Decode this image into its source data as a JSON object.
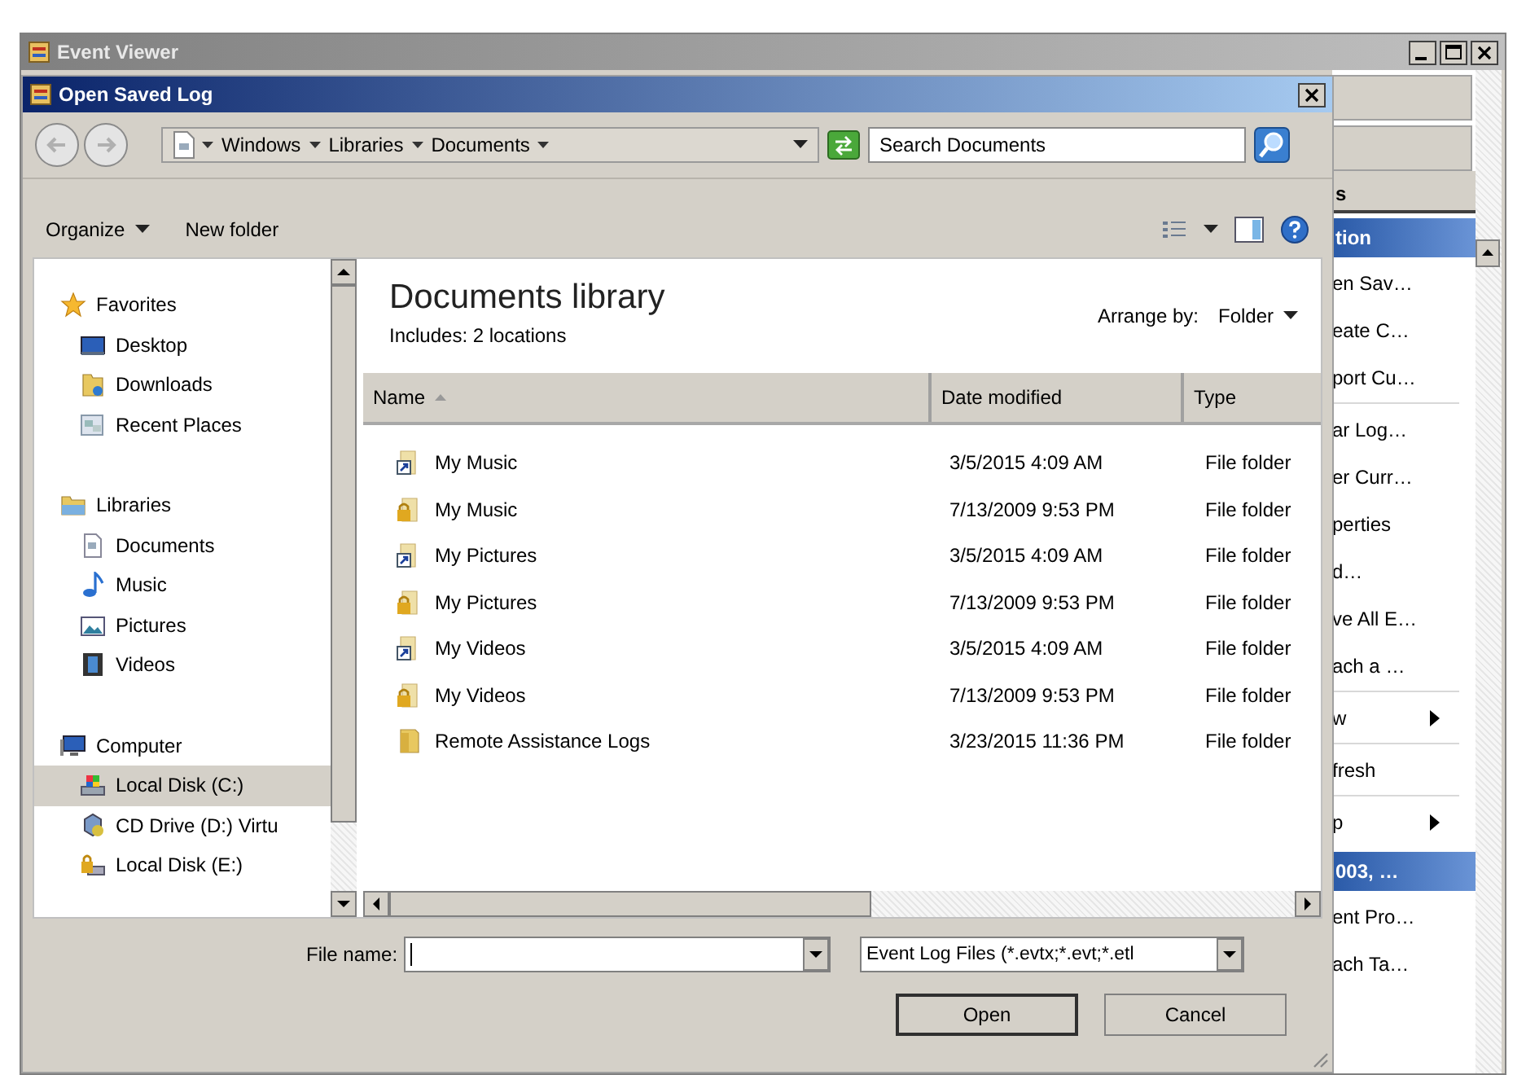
{
  "main_window": {
    "title": "Event Viewer"
  },
  "actions_panel": {
    "section_label": "s",
    "sections": [
      {
        "title": "tion",
        "groups": [
          [
            {
              "label": "en Sav…",
              "kind": "action"
            },
            {
              "label": "eate C…",
              "kind": "action"
            },
            {
              "label": "port Cu…",
              "kind": "action"
            }
          ],
          [
            {
              "label": "ar Log…",
              "kind": "action"
            },
            {
              "label": "er Curr…",
              "kind": "action"
            },
            {
              "label": "perties",
              "kind": "action"
            },
            {
              "label": "d…",
              "kind": "action"
            },
            {
              "label": "ve All E…",
              "kind": "action"
            },
            {
              "label": "ach a …",
              "kind": "action"
            }
          ],
          [
            {
              "label": "w",
              "kind": "submenu"
            }
          ],
          [
            {
              "label": "fresh",
              "kind": "action"
            }
          ],
          [
            {
              "label": "p",
              "kind": "submenu"
            }
          ]
        ]
      },
      {
        "title": "003, …",
        "groups": [
          [
            {
              "label": "ent Pro…",
              "kind": "action"
            },
            {
              "label": "ach Ta…",
              "kind": "action"
            }
          ]
        ]
      }
    ]
  },
  "dialog": {
    "title": "Open Saved Log",
    "breadcrumb": [
      "Windows",
      "Libraries",
      "Documents"
    ],
    "search": {
      "placeholder": "Search Documents"
    },
    "toolbar": [
      {
        "label": "Organize",
        "kind": "menu"
      },
      {
        "label": "New folder",
        "kind": "plain"
      }
    ],
    "navigation": [
      {
        "label": "Favorites",
        "kind": "star",
        "items": [
          {
            "label": "Desktop",
            "kind": "monitor",
            "selected": false
          },
          {
            "label": "Downloads",
            "kind": "downloads",
            "selected": false
          },
          {
            "label": "Recent Places",
            "kind": "recent",
            "selected": false
          }
        ]
      },
      {
        "label": "Libraries",
        "kind": "libraries",
        "items": [
          {
            "label": "Documents",
            "kind": "document",
            "selected": false
          },
          {
            "label": "Music",
            "kind": "music",
            "selected": false
          },
          {
            "label": "Pictures",
            "kind": "pictures",
            "selected": false
          },
          {
            "label": "Videos",
            "kind": "videos",
            "selected": false
          }
        ]
      },
      {
        "label": "Computer",
        "kind": "computer",
        "items": [
          {
            "label": "Local Disk (C:)",
            "kind": "drive",
            "selected": true
          },
          {
            "label": "CD Drive (D:) Virtu",
            "kind": "cd",
            "selected": false
          },
          {
            "label": "Local Disk (E:)",
            "kind": "lockdrive",
            "selected": false
          }
        ]
      }
    ],
    "library": {
      "title": "Documents library",
      "subtitle": "Includes:  2 locations",
      "arrange_label": "Arrange by:",
      "arrange_value": "Folder"
    },
    "columns": [
      {
        "label": "Name",
        "sorted": true
      },
      {
        "label": "Date modified",
        "sorted": false
      },
      {
        "label": "Type",
        "sorted": false
      }
    ],
    "rows": [
      {
        "name": "My Music",
        "kind": "shortcut",
        "date": "3/5/2015 4:09 AM",
        "type": "File folder"
      },
      {
        "name": "My Music",
        "kind": "locked",
        "date": "7/13/2009 9:53 PM",
        "type": "File folder"
      },
      {
        "name": "My Pictures",
        "kind": "shortcut",
        "date": "3/5/2015 4:09 AM",
        "type": "File folder"
      },
      {
        "name": "My Pictures",
        "kind": "locked",
        "date": "7/13/2009 9:53 PM",
        "type": "File folder"
      },
      {
        "name": "My Videos",
        "kind": "shortcut",
        "date": "3/5/2015 4:09 AM",
        "type": "File folder"
      },
      {
        "name": "My Videos",
        "kind": "locked",
        "date": "7/13/2009 9:53 PM",
        "type": "File folder"
      },
      {
        "name": "Remote Assistance Logs",
        "kind": "folder",
        "date": "3/23/2015 11:36 PM",
        "type": "File folder"
      }
    ],
    "file_name": {
      "label": "File name:"
    },
    "file_type": "Event Log Files (*.evtx;*.evt;*.etl",
    "buttons": [
      {
        "label": "Open",
        "default": true
      },
      {
        "label": "Cancel",
        "default": false
      }
    ]
  }
}
